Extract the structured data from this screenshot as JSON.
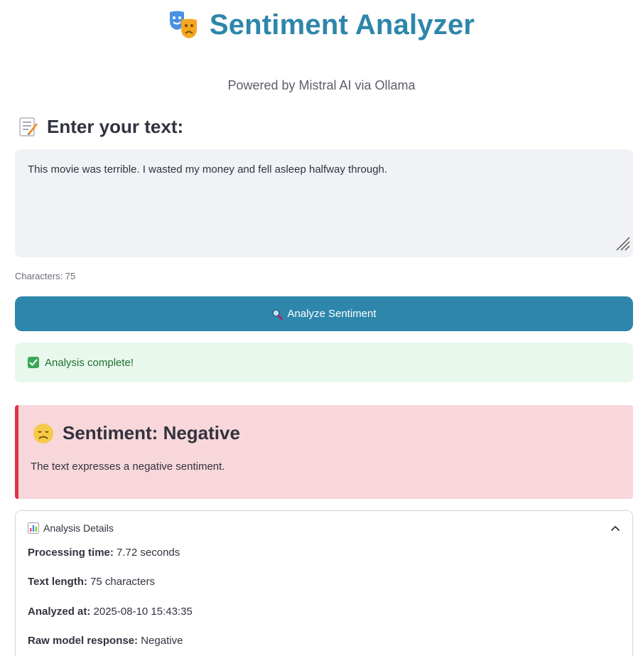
{
  "header": {
    "title": "Sentiment Analyzer",
    "title_icon": "theater-masks-icon",
    "subtitle": "Powered by Mistral AI via Ollama"
  },
  "input": {
    "section_title": "Enter your text:",
    "section_icon": "memo-icon",
    "value": "This movie was terrible. I wasted my money and fell asleep halfway through.",
    "char_count": "Characters: 75"
  },
  "analyze_button": {
    "label": "Analyze Sentiment",
    "icon": "magnifier-icon"
  },
  "status": {
    "message": "Analysis complete!",
    "icon": "check-box-icon"
  },
  "result": {
    "title": "Sentiment: Negative",
    "icon": "disappointed-face-icon",
    "description": "The text expresses a negative sentiment."
  },
  "details": {
    "header": "Analysis Details",
    "icon": "bar-chart-icon",
    "rows": [
      {
        "label": "Processing time:",
        "value": "7.72 seconds"
      },
      {
        "label": "Text length:",
        "value": "75 characters"
      },
      {
        "label": "Analyzed at:",
        "value": "2025-08-10 15:43:35"
      },
      {
        "label": "Raw model response:",
        "value": "Negative"
      }
    ]
  },
  "colors": {
    "accent": "#2e86ab",
    "success_bg": "#e8f8ec",
    "success_text": "#1f6f32",
    "negative_bg": "#f8d7da",
    "negative_border": "#dc3545"
  }
}
